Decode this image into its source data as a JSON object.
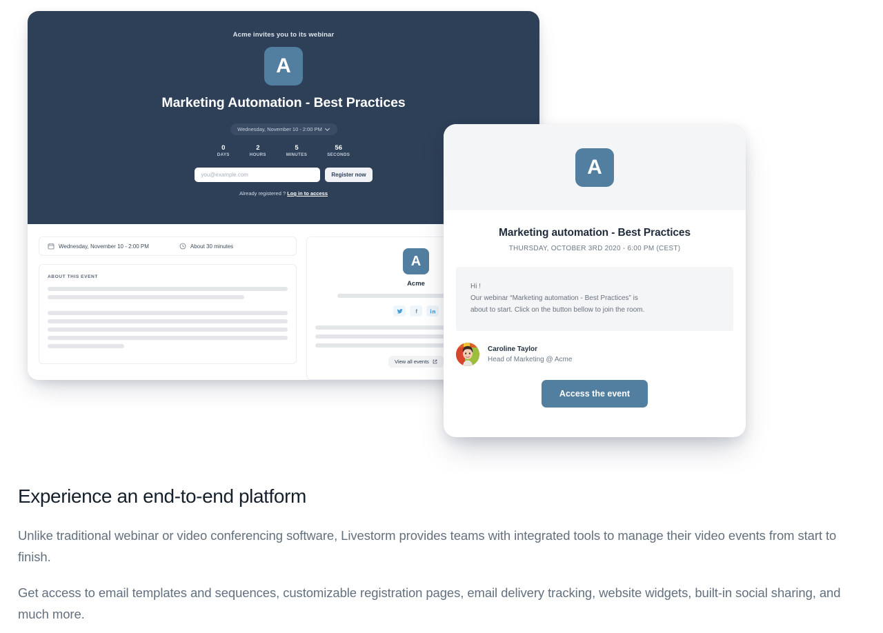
{
  "registration_page": {
    "kicker": "Acme invites you to its webinar",
    "logo_letter": "A",
    "title": "Marketing Automation - Best Practices",
    "date_select": {
      "value": "Wednesday, November 10 - 2:00 PM",
      "chevron_icon": "chevron-down-icon"
    },
    "countdown": [
      {
        "value": "0",
        "label": "DAYS"
      },
      {
        "value": "2",
        "label": "HOURS"
      },
      {
        "value": "5",
        "label": "MINUTES"
      },
      {
        "value": "56",
        "label": "SECONDS"
      }
    ],
    "email_placeholder": "you@example.com",
    "email_value": "",
    "register_button": "Register now",
    "already_registered_text": "Already registered ?",
    "login_link": "Log in to access",
    "details": {
      "date": "Wednesday, November 10 - 2:00 PM",
      "date_icon": "calendar-icon",
      "duration": "About 30 minutes",
      "duration_icon": "clock-icon",
      "about_heading": "ABOUT THIS EVENT"
    },
    "organizer": {
      "logo_letter": "A",
      "name": "Acme",
      "socials": [
        {
          "name": "twitter-icon"
        },
        {
          "name": "facebook-icon"
        },
        {
          "name": "linkedin-icon"
        }
      ],
      "view_all_events": "View all events",
      "external_link_icon": "external-link-icon"
    }
  },
  "email_preview": {
    "logo_letter": "A",
    "title": "Marketing automation - Best Practices",
    "date": "THURSDAY, OCTOBER 3RD 2020 - 6:00 PM  (CEST)",
    "message_lines": [
      "Hi !",
      "Our webinar “Marketing automation - Best Practices” is",
      "about to start. Click on the button bellow to join the room."
    ],
    "sender": {
      "name": "Caroline Taylor",
      "role": "Head of Marketing @ Acme",
      "avatar_icon": "avatar"
    },
    "cta_label": "Access the event"
  },
  "copy": {
    "heading": "Experience an end-to-end platform",
    "paragraph_1": "Unlike traditional webinar or video conferencing software, Livestorm provides teams with integrated tools to manage their video events from start to finish.",
    "paragraph_2": "Get access to email templates and sequences, customizable registration pages, email delivery tracking, website widgets, built-in social sharing, and much more."
  },
  "colors": {
    "hero_navy": "#2e4058",
    "brand_blue": "#527ea0",
    "body_text": "#63707e",
    "heading_text": "#15202b",
    "panel_gray": "#f4f5f7",
    "skeleton_gray": "#e4e6ea"
  }
}
